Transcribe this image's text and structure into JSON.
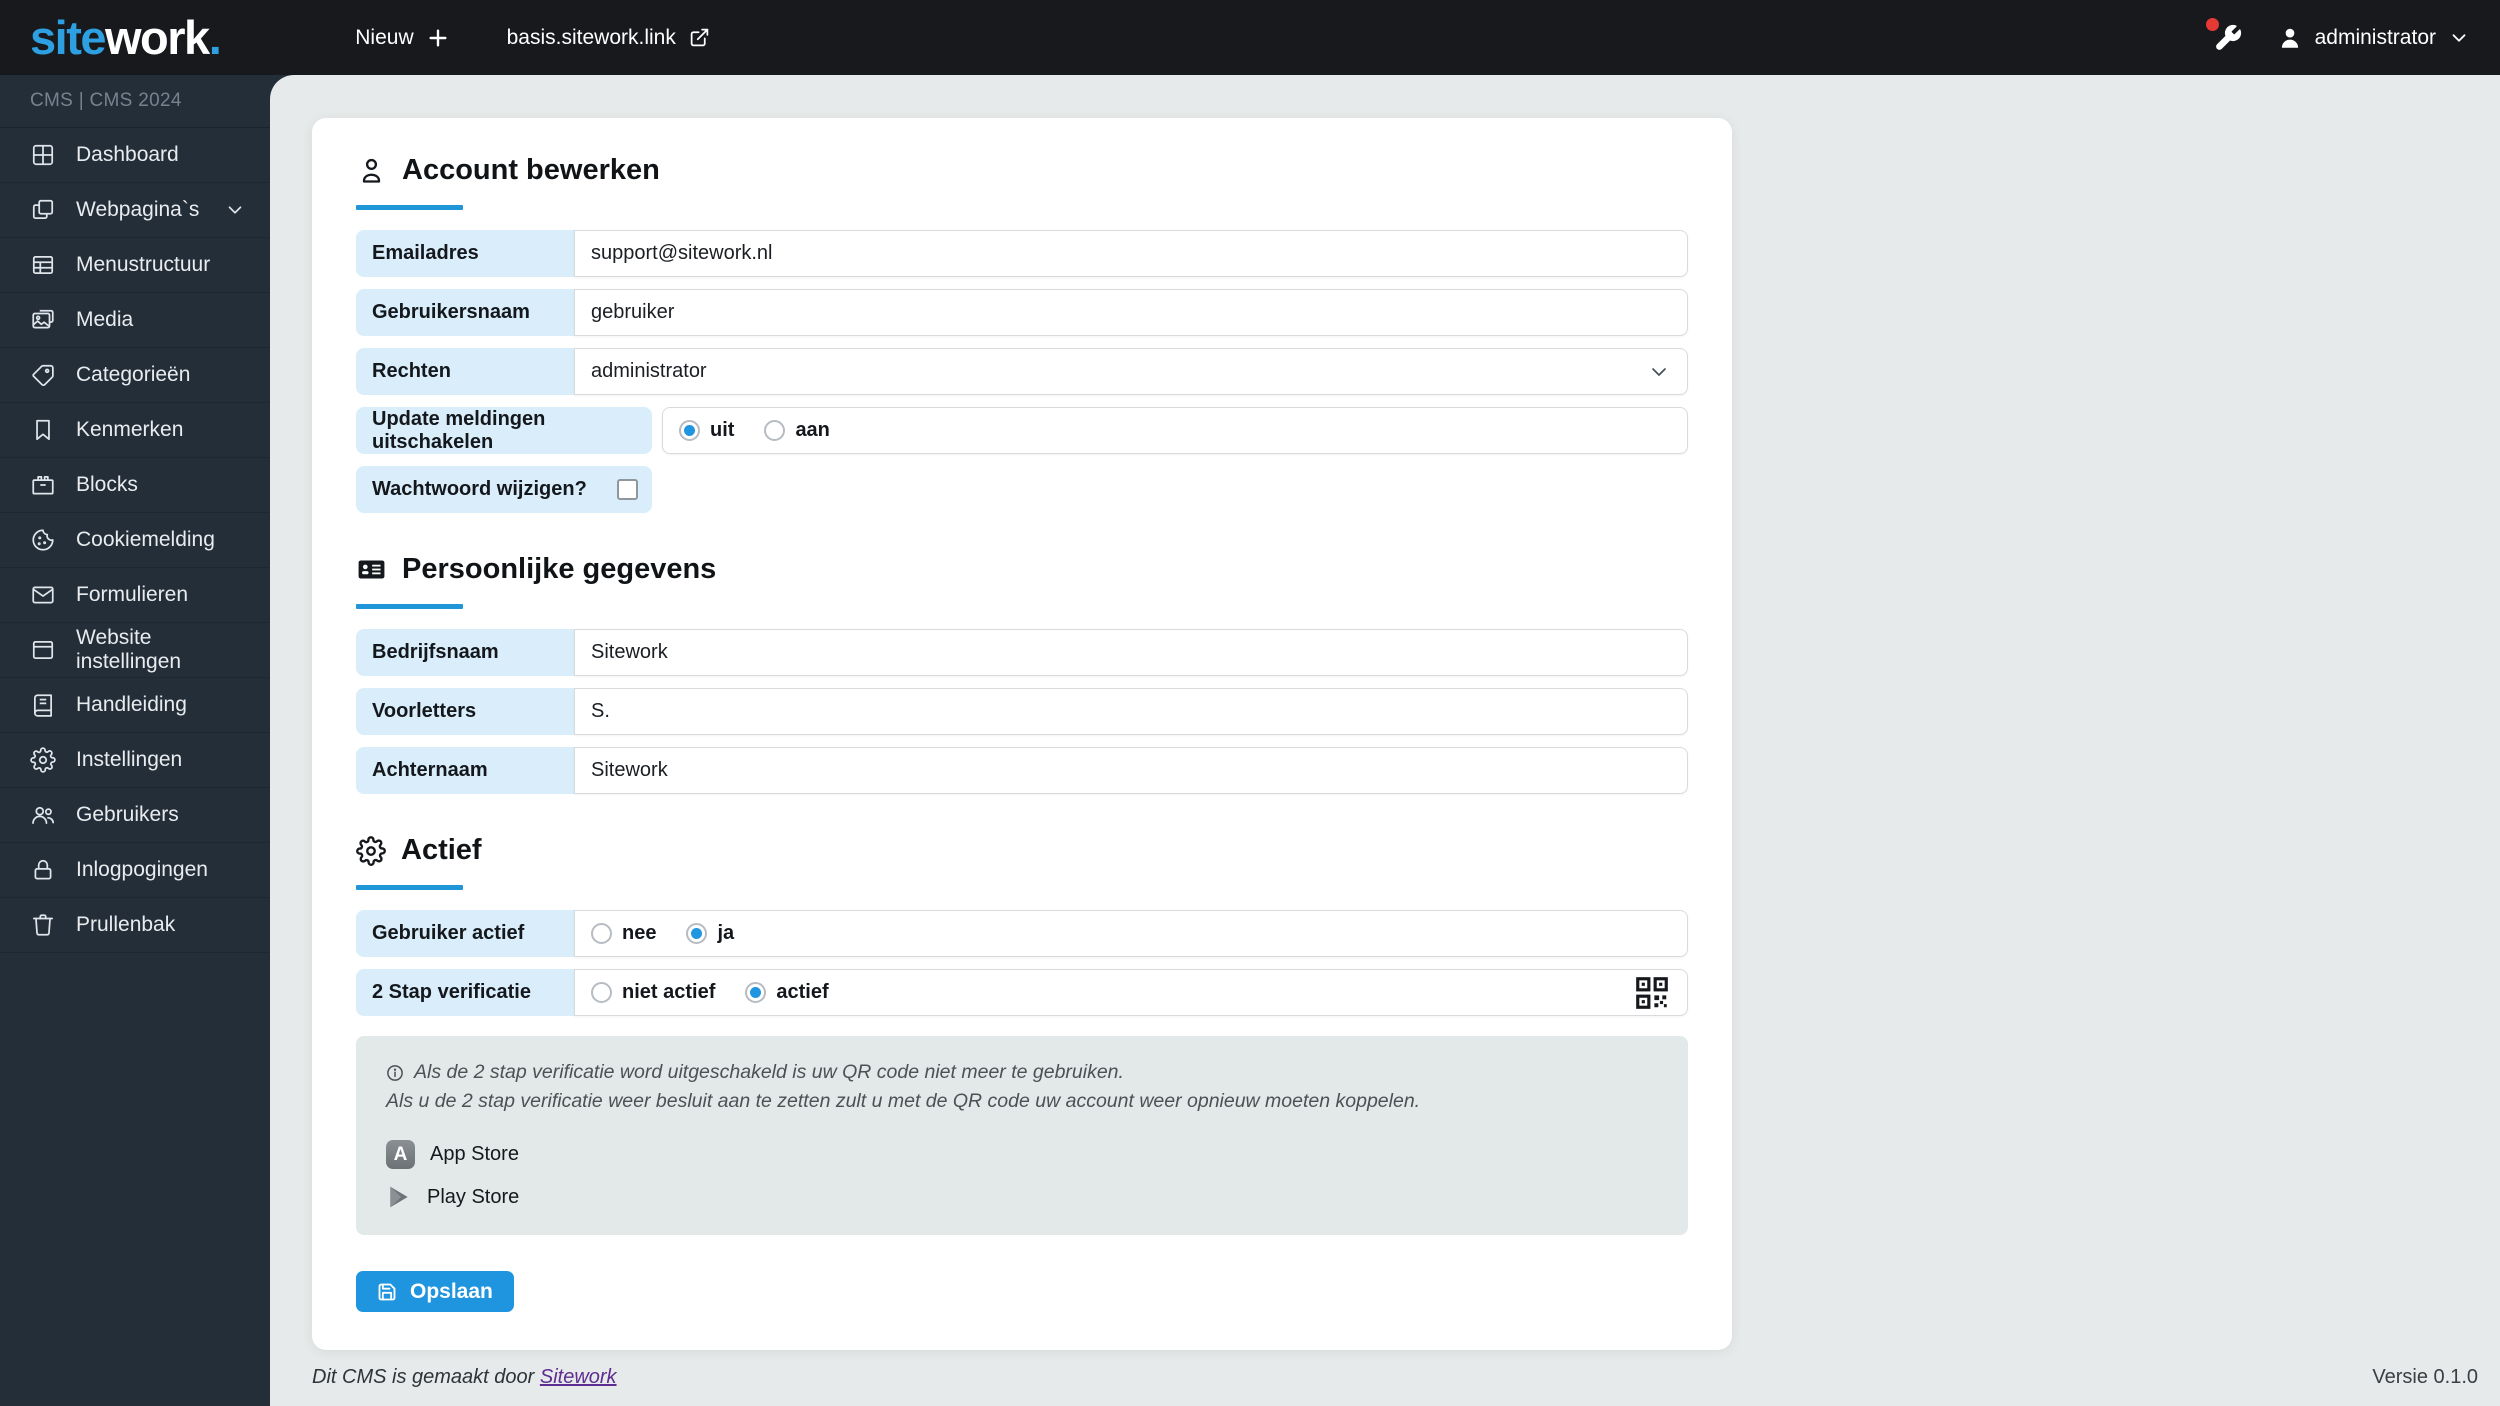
{
  "topbar": {
    "logo_site": "site",
    "logo_work": "work",
    "logo_dot": ".",
    "new_label": "Nieuw",
    "site_link": "basis.sitework.link",
    "username": "administrator"
  },
  "sidebar": {
    "header": "CMS | CMS 2024",
    "items": [
      {
        "label": "Dashboard",
        "icon": "dashboard-icon"
      },
      {
        "label": "Webpagina`s",
        "icon": "pages-icon"
      },
      {
        "label": "Menustructuur",
        "icon": "menu-structure-icon"
      },
      {
        "label": "Media",
        "icon": "media-icon"
      },
      {
        "label": "Categorieën",
        "icon": "tag-icon"
      },
      {
        "label": "Kenmerken",
        "icon": "bookmark-icon"
      },
      {
        "label": "Blocks",
        "icon": "blocks-icon"
      },
      {
        "label": "Cookiemelding",
        "icon": "cookie-icon"
      },
      {
        "label": "Formulieren",
        "icon": "mail-icon"
      },
      {
        "label": "Website instellingen",
        "icon": "browser-icon"
      },
      {
        "label": "Handleiding",
        "icon": "book-icon"
      },
      {
        "label": "Instellingen",
        "icon": "gear-icon"
      },
      {
        "label": "Gebruikers",
        "icon": "users-icon"
      },
      {
        "label": "Inlogpogingen",
        "icon": "lock-icon"
      },
      {
        "label": "Prullenbak",
        "icon": "trash-icon"
      }
    ]
  },
  "account_section": {
    "title": "Account bewerken",
    "email_label": "Emailadres",
    "email_value": "support@sitework.nl",
    "username_label": "Gebruikersnaam",
    "username_value": "gebruiker",
    "rights_label": "Rechten",
    "rights_value": "administrator",
    "updates_label": "Update meldingen uitschakelen",
    "updates_options": [
      "uit",
      "aan"
    ],
    "updates_selected": "uit",
    "password_label": "Wachtwoord wijzigen?",
    "password_checked": false
  },
  "personal_section": {
    "title": "Persoonlijke gegevens",
    "company_label": "Bedrijfsnaam",
    "company_value": "Sitework",
    "initials_label": "Voorletters",
    "initials_value": "S.",
    "lastname_label": "Achternaam",
    "lastname_value": "Sitework"
  },
  "active_section": {
    "title": "Actief",
    "user_active_label": "Gebruiker actief",
    "user_active_options": [
      "nee",
      "ja"
    ],
    "user_active_selected": "ja",
    "two_step_label": "2 Stap verificatie",
    "two_step_options": [
      "niet actief",
      "actief"
    ],
    "two_step_selected": "actief"
  },
  "info_box": {
    "line1": "Als de 2 stap verificatie word uitgeschakeld is uw QR code niet meer te gebruiken.",
    "line2": "Als u de 2 stap verificatie weer besluit aan te zetten zult u met de QR code uw account weer opnieuw moeten koppelen.",
    "app_store": "App Store",
    "play_store": "Play Store"
  },
  "save_label": "Opslaan",
  "footer": {
    "credit_text": "Dit CMS is gemaakt door ",
    "credit_link": "Sitework",
    "version": "Versie 0.1.0"
  },
  "colors": {
    "accent_blue": "#2096df",
    "label_blue": "#d9edfb",
    "topbar_bg": "#17191d",
    "sidebar_bg": "#242e39",
    "page_bg": "#e7eaea",
    "info_bg": "#e3e8e8",
    "alert_red": "#e53935",
    "link_purple": "#5e2d91"
  }
}
